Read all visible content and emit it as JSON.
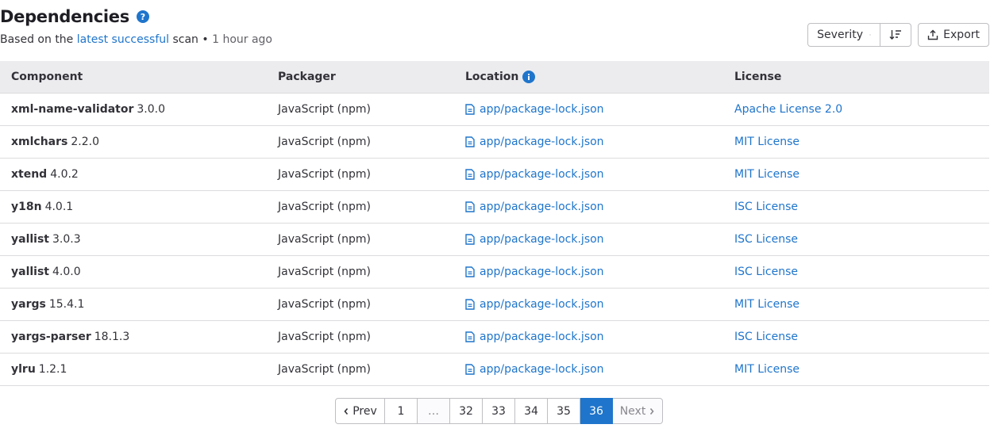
{
  "header": {
    "title": "Dependencies",
    "subtitle_prefix": "Based on the ",
    "subtitle_link": "latest successful",
    "subtitle_suffix": " scan",
    "subtitle_sep": " • ",
    "subtitle_time": "1 hour ago"
  },
  "toolbar": {
    "sort_label": "Severity",
    "export_label": "Export"
  },
  "columns": [
    "Component",
    "Packager",
    "Location",
    "License"
  ],
  "rows": [
    {
      "name": "xml-name-validator",
      "version": "3.0.0",
      "packager": "JavaScript (npm)",
      "location": "app/package-lock.json",
      "license": "Apache License 2.0"
    },
    {
      "name": "xmlchars",
      "version": "2.2.0",
      "packager": "JavaScript (npm)",
      "location": "app/package-lock.json",
      "license": "MIT License"
    },
    {
      "name": "xtend",
      "version": "4.0.2",
      "packager": "JavaScript (npm)",
      "location": "app/package-lock.json",
      "license": "MIT License"
    },
    {
      "name": "y18n",
      "version": "4.0.1",
      "packager": "JavaScript (npm)",
      "location": "app/package-lock.json",
      "license": "ISC License"
    },
    {
      "name": "yallist",
      "version": "3.0.3",
      "packager": "JavaScript (npm)",
      "location": "app/package-lock.json",
      "license": "ISC License"
    },
    {
      "name": "yallist",
      "version": "4.0.0",
      "packager": "JavaScript (npm)",
      "location": "app/package-lock.json",
      "license": "ISC License"
    },
    {
      "name": "yargs",
      "version": "15.4.1",
      "packager": "JavaScript (npm)",
      "location": "app/package-lock.json",
      "license": "MIT License"
    },
    {
      "name": "yargs-parser",
      "version": "18.1.3",
      "packager": "JavaScript (npm)",
      "location": "app/package-lock.json",
      "license": "ISC License"
    },
    {
      "name": "ylru",
      "version": "1.2.1",
      "packager": "JavaScript (npm)",
      "location": "app/package-lock.json",
      "license": "MIT License"
    }
  ],
  "pagination": {
    "prev": "Prev",
    "first": "1",
    "ellipsis": "…",
    "pages": [
      "32",
      "33",
      "34",
      "35",
      "36"
    ],
    "current": "36",
    "next": "Next"
  },
  "colors": {
    "link": "#1f75cb",
    "header_bg": "#ececef",
    "active_page": "#1f75cb"
  },
  "icons": [
    "question-circle-icon",
    "chevron-down-icon",
    "sort-lowest-icon",
    "export-icon",
    "info-circle-icon",
    "document-icon",
    "chevron-left-icon",
    "chevron-right-icon"
  ]
}
